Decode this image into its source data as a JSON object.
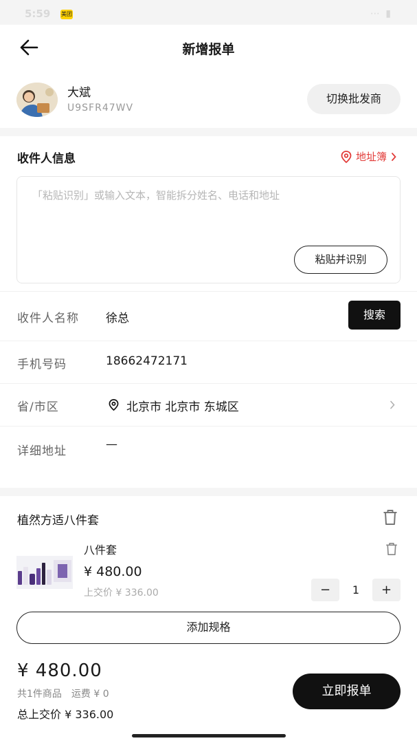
{
  "status_bar": {
    "time": "5:59",
    "app_badge": "美团",
    "right_icons": "⋯ ▮"
  },
  "nav": {
    "title": "新增报单"
  },
  "user": {
    "name": "大斌",
    "id": "U9SFR47WV",
    "switch_label": "切换批发商"
  },
  "recipient": {
    "section_title": "收件人信息",
    "address_book_label": "地址簿",
    "paste_placeholder": "「粘贴识别」或输入文本，智能拆分姓名、电话和地址",
    "paste_button": "粘贴并识别"
  },
  "form": {
    "name_label": "收件人名称",
    "name_value": "徐总",
    "search_button": "搜索",
    "phone_label": "手机号码",
    "phone_value": "18662472171",
    "region_label": "省/市区",
    "region_value": "北京市 北京市 东城区",
    "address_label": "详细地址",
    "address_value": "—"
  },
  "product": {
    "title": "植然方适八件套",
    "sku_name": "八件套",
    "sku_price": "¥ 480.00",
    "sku_supply_price": "上交价 ¥ 336.00",
    "quantity": "1",
    "minus_label": "−",
    "plus_label": "+",
    "add_spec_label": "添加规格"
  },
  "footer": {
    "total_price": "¥ 480.00",
    "summary": "共1件商品　运费 ¥ 0",
    "total_supply": "总上交价 ¥ 336.00",
    "submit_label": "立即报单"
  },
  "colors": {
    "accent_red": "#e23c39",
    "primary_black": "#111111"
  },
  "icons": [
    "back-arrow-icon",
    "location-pin-icon",
    "chevron-right-icon",
    "trash-icon"
  ]
}
